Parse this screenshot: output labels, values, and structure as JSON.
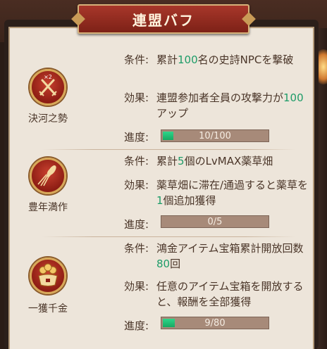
{
  "title": "連盟バフ",
  "colors": {
    "accent_green": "#1e9c68",
    "title_red": "#8d1d14",
    "bar_fill": "#2ed68a"
  },
  "buffs": [
    {
      "name": "決河之勢",
      "icon": "crossed-swords-x2-icon",
      "icon_badge": "×2",
      "condition_label": "条件:",
      "condition_pre": "累計",
      "condition_num": "100",
      "condition_post": "名の史詩NPCを撃破",
      "effect_label": "効果:",
      "effect_pre": "連盟参加者全員の攻撃力が",
      "effect_num": "100",
      "effect_post": "アップ",
      "progress_label": "進度:",
      "progress_text": "10/100",
      "progress": 0.1
    },
    {
      "name": "豊年満作",
      "icon": "wheat-sheaf-icon",
      "condition_label": "条件:",
      "condition_pre": "累計",
      "condition_num": "5",
      "condition_post": "個のLvMAX薬草畑",
      "effect_label": "効果:",
      "effect_pre": "薬草畑に滞在/通過すると薬草を",
      "effect_num": "1",
      "effect_post": "個追加獲得",
      "progress_label": "進度:",
      "progress_text": "0/5",
      "progress": 0.0
    },
    {
      "name": "一獲千金",
      "icon": "treasure-gold-icon",
      "condition_label": "条件:",
      "condition_pre": "鴻金アイテム宝箱累計開放回数",
      "condition_num": "80",
      "condition_post": "回",
      "effect_label": "効果:",
      "effect_pre": "任意のアイテム宝箱を開放すると、報酬を全部獲得",
      "effect_num": "",
      "effect_post": "",
      "progress_label": "進度:",
      "progress_text": "9/80",
      "progress": 0.1125
    }
  ]
}
